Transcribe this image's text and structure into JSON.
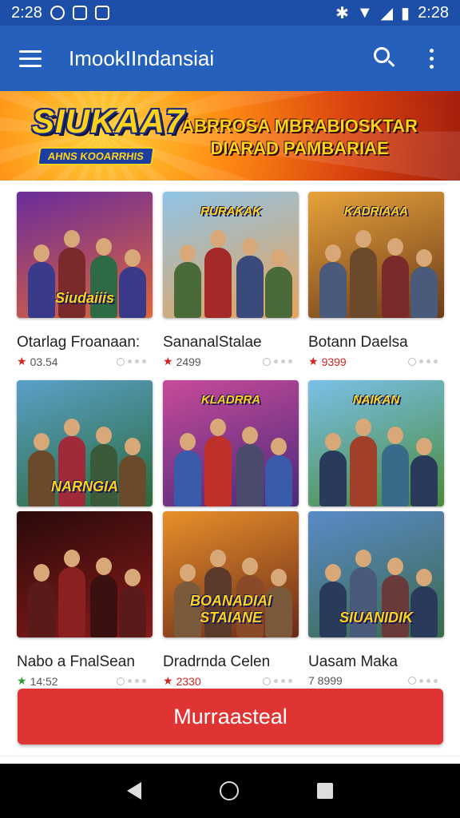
{
  "status_bar": {
    "time_left": "2:28",
    "time_right": "2:28"
  },
  "app_bar": {
    "title": "ImookIIndansiai"
  },
  "banner": {
    "logo_text": "SIUKAA7",
    "logo_subtext": "AHNS KOOARRHIS",
    "headline_line1": "ABRROSA MBRABIOSKTAR",
    "headline_line2": "DIARAD PAMBARIAE"
  },
  "games": [
    {
      "thumb_label": "Siudaiiis",
      "thumb_label_pos": "bottom",
      "title": "Otarlag Froanaan:",
      "rating": "03.54",
      "star": "red",
      "rating_color": "gray",
      "colors": {
        "bg1": "#6a2c9c",
        "bg2": "#e0663a",
        "f1": "#3a3a8a",
        "f2": "#7a2a2a",
        "f3": "#2e6a44"
      }
    },
    {
      "thumb_label": "RURAKAK",
      "thumb_label_pos": "top",
      "title": "SananalStalae",
      "rating": "2499",
      "star": "red",
      "rating_color": "gray",
      "colors": {
        "bg1": "#8fc4e8",
        "bg2": "#e8a45a",
        "f1": "#4a6a3a",
        "f2": "#a42a2a",
        "f3": "#3a4a7a"
      }
    },
    {
      "thumb_label": "KADRIAAA",
      "thumb_label_pos": "top",
      "title": "Botann Daelsa",
      "rating": "9399",
      "star": "red",
      "rating_color": "red",
      "colors": {
        "bg1": "#e8a23a",
        "bg2": "#6a3a1a",
        "f1": "#4a5a7a",
        "f2": "#6a4a2a",
        "f3": "#7a2a2a"
      }
    },
    {
      "thumb_label": "NARNGIA",
      "thumb_label_pos": "bottom",
      "title": "",
      "rating": "",
      "star": "",
      "rating_color": "gray",
      "colors": {
        "bg1": "#5aa0c8",
        "bg2": "#2a6a3a",
        "f1": "#6a4a2a",
        "f2": "#a02a3a",
        "f3": "#3a5a3a"
      }
    },
    {
      "thumb_label": "KLADRRA",
      "thumb_label_pos": "top",
      "title": "",
      "rating": "",
      "star": "",
      "rating_color": "gray",
      "colors": {
        "bg1": "#c84a9a",
        "bg2": "#4a2a7a",
        "f1": "#3a5aaa",
        "f2": "#c0302a",
        "f3": "#4a4a6a"
      }
    },
    {
      "thumb_label": "NAIKAN",
      "thumb_label_pos": "top",
      "title": "",
      "rating": "",
      "star": "",
      "rating_color": "gray",
      "colors": {
        "bg1": "#7ac0e8",
        "bg2": "#4a8a3a",
        "f1": "#2a3a5a",
        "f2": "#a0402a",
        "f3": "#3a6a8a"
      }
    },
    {
      "thumb_label": "",
      "thumb_label_pos": "bottom",
      "title": "Nabo a FnalSean",
      "rating": "14:52",
      "star": "green",
      "rating_color": "gray",
      "colors": {
        "bg1": "#2a0a0a",
        "bg2": "#8a1a1a",
        "f1": "#5a1a1a",
        "f2": "#8a2020",
        "f3": "#3a1010"
      }
    },
    {
      "thumb_label": "BOANADIAI STAIANE",
      "thumb_label_pos": "bottom",
      "title": "Dradrnda Celen",
      "rating": "2330",
      "star": "red",
      "rating_color": "red",
      "colors": {
        "bg1": "#e8902a",
        "bg2": "#6a2a1a",
        "f1": "#7a5a3a",
        "f2": "#5a3a2a",
        "f3": "#8a4a2a"
      }
    },
    {
      "thumb_label": "SIUANIDIK",
      "thumb_label_pos": "bottom",
      "title": "Uasam Maka",
      "rating": "7 8999",
      "star": "",
      "rating_color": "gray",
      "colors": {
        "bg1": "#5a8ac8",
        "bg2": "#3a6a4a",
        "f1": "#2a3a5a",
        "f2": "#4a5a7a",
        "f3": "#6a3a3a"
      }
    }
  ],
  "cta": {
    "label": "Murraasteal"
  }
}
